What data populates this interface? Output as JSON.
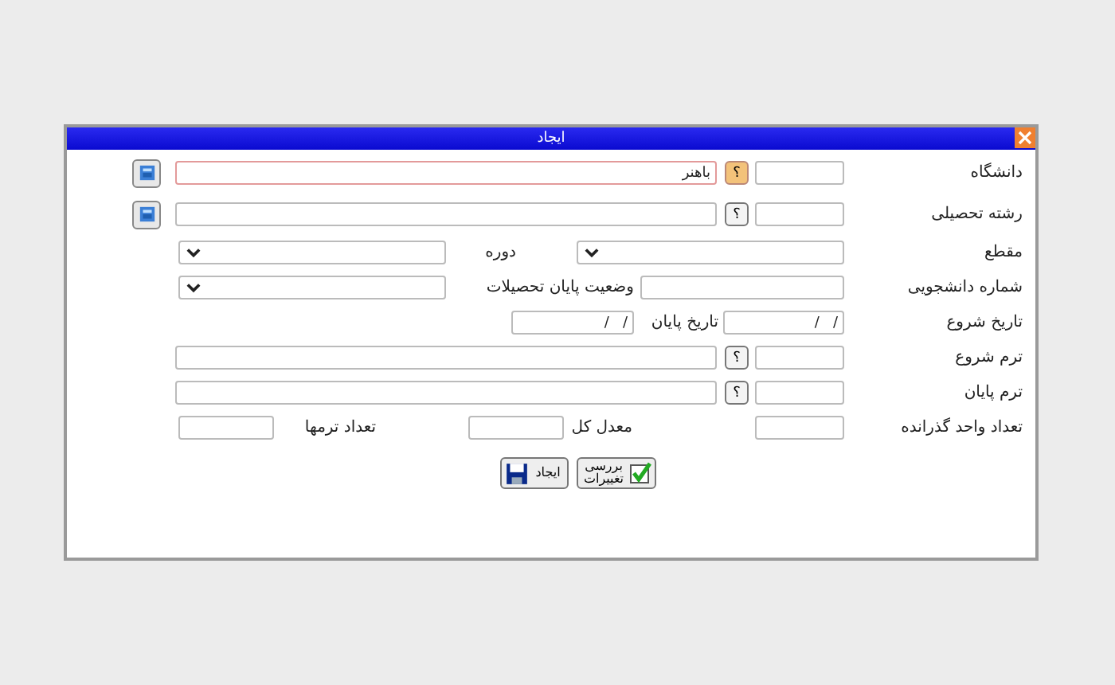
{
  "window": {
    "title": "ایجاد"
  },
  "rows": [
    {
      "kind": "lookup",
      "label": "دانشگاه",
      "help": "؟",
      "value": "باهنر",
      "focused": true,
      "help_highlighted": true,
      "side_button": true
    },
    {
      "kind": "lookup",
      "label": "رشته تحصیلی",
      "help": "؟",
      "focused": false,
      "help_highlighted": false,
      "side_button": true
    },
    {
      "kind": "select_pair",
      "label": "مقطع",
      "label2": "دوره"
    },
    {
      "kind": "field_select",
      "label": "شماره دانشجویی",
      "label2": "وضعیت پایان تحصیلات"
    },
    {
      "kind": "dates",
      "label": "تاریخ شروع",
      "date1": "/   /",
      "label2": "تاریخ پایان",
      "date2": "/   /"
    },
    {
      "kind": "lookup",
      "label": "ترم شروع",
      "help": "؟",
      "focused": false,
      "help_highlighted": false,
      "side_button": false
    },
    {
      "kind": "lookup",
      "label": "ترم پایان",
      "help": "؟",
      "focused": false,
      "help_highlighted": false,
      "side_button": false
    },
    {
      "kind": "counts",
      "label": "تعداد واحد گذرانده",
      "label2": "معدل کل",
      "label3": "تعداد ترمها"
    }
  ],
  "buttons": [
    {
      "kind": "review",
      "label": "بررسی تغییرات"
    },
    {
      "kind": "save",
      "label": "ایجاد"
    }
  ]
}
